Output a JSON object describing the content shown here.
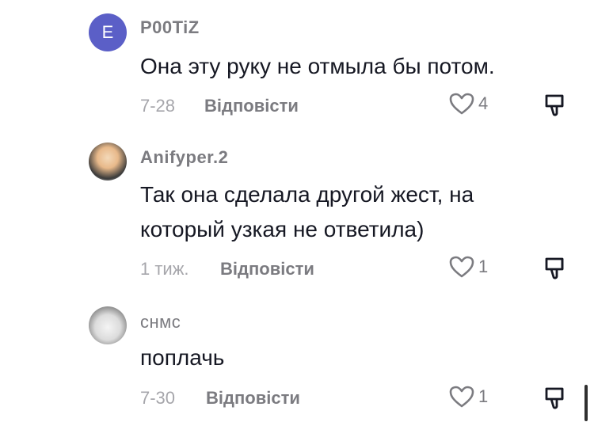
{
  "comments": [
    {
      "avatar_letter": "E",
      "avatar_color": "#5b5fc7",
      "username": "P00TiZ",
      "text": "Она эту руку не отмыла бы потом.",
      "time": "7-28",
      "reply_label": "Відповісти",
      "likes": "4"
    },
    {
      "avatar_letter": "",
      "username": "Anifyper.2",
      "text": "Так она сделала другой жест, на который узкая не ответила)",
      "time": "1 тиж.",
      "reply_label": "Відповісти",
      "likes": "1"
    },
    {
      "avatar_letter": "",
      "username": "снмс",
      "text": "поплачь",
      "time": "7-30",
      "reply_label": "Відповісти",
      "likes": "1"
    }
  ]
}
